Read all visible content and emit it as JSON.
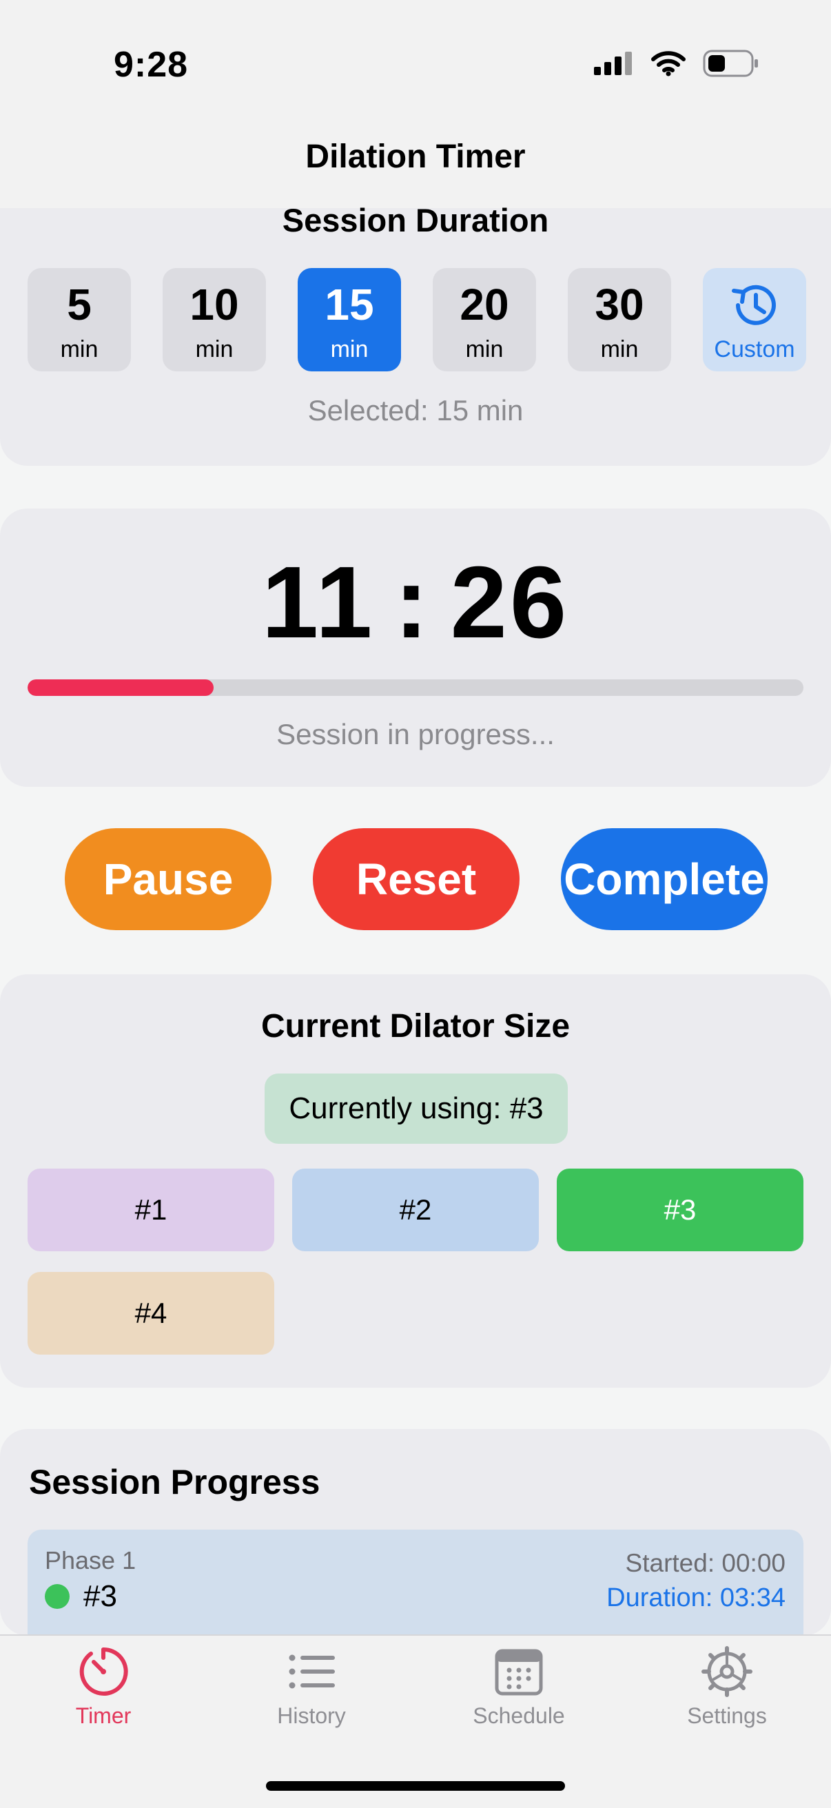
{
  "status_bar": {
    "time": "9:28"
  },
  "nav": {
    "title": "Dilation Timer"
  },
  "duration": {
    "heading": "Session Duration",
    "options": [
      {
        "value": "5",
        "unit": "min"
      },
      {
        "value": "10",
        "unit": "min"
      },
      {
        "value": "15",
        "unit": "min"
      },
      {
        "value": "20",
        "unit": "min"
      },
      {
        "value": "30",
        "unit": "min"
      }
    ],
    "custom_label": "Custom",
    "selected_text": "Selected: 15 min",
    "selected_value": "15"
  },
  "timer": {
    "minutes": "11",
    "separator": ":",
    "seconds": "26",
    "progress_fraction": 0.24,
    "status": "Session in progress..."
  },
  "actions": {
    "pause_label": "Pause",
    "reset_label": "Reset",
    "complete_label": "Complete"
  },
  "dilator": {
    "heading": "Current Dilator Size",
    "current_text": "Currently using: #3",
    "sizes": [
      {
        "label": "#1",
        "color": "#decceb",
        "text_color": "#000000"
      },
      {
        "label": "#2",
        "color": "#bdd3ee",
        "text_color": "#000000"
      },
      {
        "label": "#3",
        "color": "#3cc25a",
        "text_color": "#ffffff"
      },
      {
        "label": "#4",
        "color": "#ecd9c0",
        "text_color": "#000000"
      }
    ]
  },
  "progress": {
    "heading": "Session Progress",
    "phases": [
      {
        "label": "Phase 1",
        "size": "#3",
        "started": "Started: 00:00",
        "duration": "Duration: 03:34"
      }
    ]
  },
  "tabs": [
    {
      "label": "Timer",
      "icon": "timer-icon",
      "active": true
    },
    {
      "label": "History",
      "icon": "list-icon",
      "active": false
    },
    {
      "label": "Schedule",
      "icon": "calendar-icon",
      "active": false
    },
    {
      "label": "Settings",
      "icon": "gear-icon",
      "active": false
    }
  ],
  "colors": {
    "accent": "#1a73e8",
    "pause": "#f18d1f",
    "reset": "#f03b32",
    "complete": "#1a73e8",
    "progress_fill": "#ee2d55",
    "tab_active": "#e2375a"
  }
}
